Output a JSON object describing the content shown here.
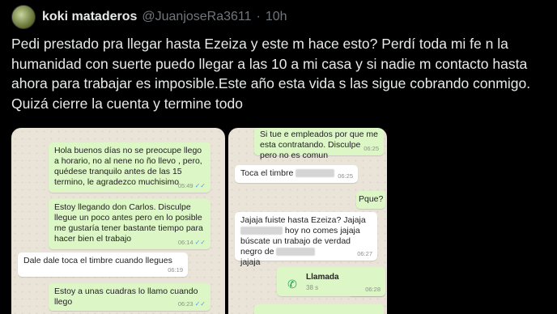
{
  "tweet": {
    "display_name": "koki mataderos",
    "handle": "@JuanjoseRa3611",
    "separator": "·",
    "time": "10h",
    "text": "Pedi prestado pra llegar hasta Ezeiza y este m hace esto? Perdí toda mi fe n la humanidad con suerte puedo llegar a las 10 a mi casa y si nadie m contacto hasta ahora para trabajar es imposible.Este año esta vida s las sigue cobrando conmigo. Quizá cierre la cuenta y termine todo"
  },
  "chat_left": {
    "messages": [
      {
        "text": "Hola buenos días no se preocupe llego a horario, no al nene no ño llevo , pero, quédese tranquilo antes de las 15 termino, le agradezco muchisimo",
        "time": "05:49"
      },
      {
        "text": "Estoy llegando don Carlos. Disculpe llegue un poco antes pero en lo posible me gustaría tener bastante tiempo para hacer bien el trabajo",
        "time": "06:14"
      },
      {
        "text": "Dale dale toca el timbre cuando llegues",
        "time": "06:19"
      },
      {
        "text": "Estoy a unas cuadras lo llamo cuando llego",
        "time": "06:23"
      }
    ]
  },
  "chat_right": {
    "messages": [
      {
        "text": "Si tue e empleados por que me esta contratando. Disculpe pero no es comun",
        "time": "06:25"
      },
      {
        "text": "Toca el timbre",
        "time": "06:25"
      },
      {
        "text": "Pque?",
        "time": "06:26"
      },
      {
        "text_a": "Jajaja fuiste hasta Ezeiza? Jajaja",
        "text_b": "hoy no comes jajaja búscate un trabajo de verdad negro de",
        "text_c": "jajaja",
        "time": "06:27"
      },
      {
        "title": "Llamada",
        "sub": "38 s",
        "time": "06:28"
      }
    ]
  },
  "colors": {
    "outgoing": "#dcf7c5",
    "incoming": "#ffffff",
    "call_icon": "#1f9e5a",
    "check": "#4fa3e0"
  }
}
